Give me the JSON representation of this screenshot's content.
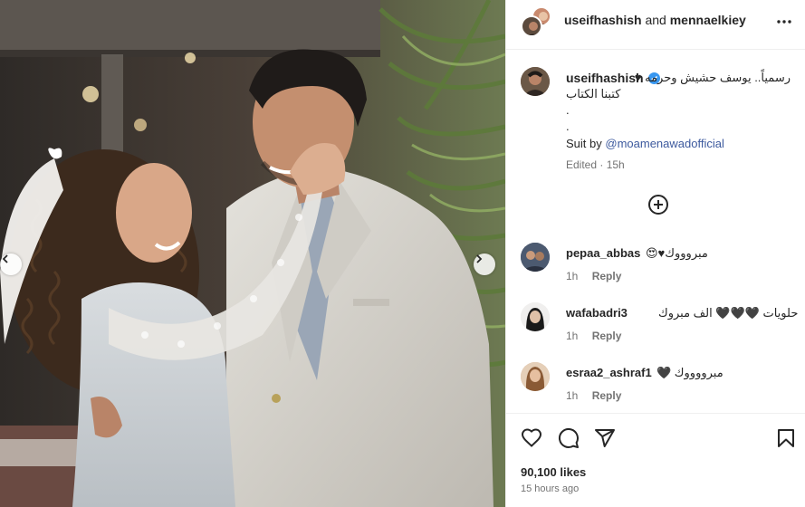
{
  "header": {
    "user1": "useifhashish",
    "and": "and",
    "user2": "mennaelkiey"
  },
  "caption": {
    "username": "useifhashish",
    "line1": "رسمياً.. يوسف حشيش وحرمه ♥",
    "line2": "كتبنا الكتاب",
    "dot1": ".",
    "dot2": ".",
    "suit_prefix": "Suit by",
    "suit_mention": "@moamenawadofficial",
    "edited_prefix": "Edited",
    "edited_time": "15h"
  },
  "comments": [
    {
      "username": "pepaa_abbas",
      "text": "مبروووك♥😍",
      "time": "1h",
      "reply": "Reply"
    },
    {
      "username": "wafabadri3",
      "text": "حلويات 🖤🖤🖤 الف مبروك",
      "time": "1h",
      "reply": "Reply"
    },
    {
      "username": "esraa2_ashraf1",
      "text": "مبرووووك 🖤",
      "time": "1h",
      "reply": "Reply"
    }
  ],
  "likes": "90,100 likes",
  "posted": "15 hours ago",
  "icons": {
    "more": "more-options-icon",
    "verified": "verified-badge-icon",
    "load_more": "plus-circle-icon",
    "like": "heart-icon",
    "comment": "comment-bubble-icon",
    "share": "paper-plane-icon",
    "save": "bookmark-icon",
    "prev": "chevron-left-icon",
    "next": "chevron-right-icon"
  },
  "colors": {
    "mention": "#3d5a9e",
    "verified": "#3897f0",
    "muted": "#737373",
    "border": "#efefef"
  }
}
